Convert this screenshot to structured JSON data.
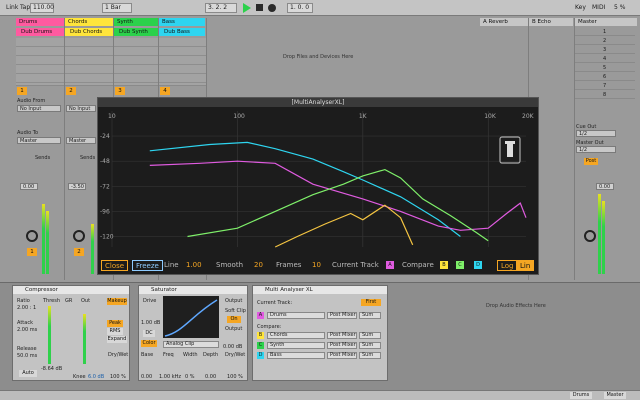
{
  "transport": {
    "link": "Link",
    "tap": "Tap",
    "tempo": "110.00",
    "bar_mode": "1 Bar",
    "position": "3. 2. 2",
    "position2": "1. 0. 0",
    "key": "Key",
    "midi": "MIDI",
    "cpu": "5 %"
  },
  "tracks": [
    {
      "name": "Drums",
      "color": "#ff5aa0",
      "clip": "Dub Drums",
      "clip_color": "#ff5aa0",
      "num": "1"
    },
    {
      "name": "Chords",
      "color": "#ffe53b",
      "clip": "Dub Chords",
      "clip_color": "#ffe53b",
      "num": "2"
    },
    {
      "name": "Synth",
      "color": "#2bd14b",
      "clip": "Dub Synth",
      "clip_color": "#2bd14b",
      "num": "3"
    },
    {
      "name": "Bass",
      "color": "#2ed5f0",
      "clip": "Dub Bass",
      "clip_color": "#2ed5f0",
      "num": "4"
    }
  ],
  "returns": {
    "a": "A Reverb",
    "b": "B Echo",
    "master": "Master"
  },
  "master_scenes": [
    "1",
    "2",
    "3",
    "4",
    "5",
    "6",
    "7",
    "8"
  ],
  "mixer": {
    "audio_from": "Audio From",
    "no_input": "No Input",
    "audio_to": "Audio To",
    "master": "Master",
    "sends": "Sends",
    "cue_out": "Cue Out",
    "cue_val": "1/2",
    "master_out": "Master Out",
    "master_out_val": "1/2",
    "post": "Post",
    "volume_vals": [
      "0.00",
      "-3.50",
      "-3.00",
      "-1.00"
    ],
    "master_vol": "0.00"
  },
  "drop_files": "Drop Files and Devices Here",
  "drop_effects": "Drop Audio Effects Here",
  "analyser": {
    "title": "[MultiAnalyserXL]",
    "freq_labels": [
      "10",
      "100",
      "1K",
      "10K",
      "20K"
    ],
    "db_labels": [
      "-24",
      "-48",
      "-72",
      "-96",
      "-120"
    ],
    "close": "Close",
    "freeze": "Freeze",
    "line_label": "Line",
    "line_val": "1.00",
    "smooth_label": "Smooth",
    "smooth_val": "20",
    "frames_label": "Frames",
    "frames_val": "10",
    "current_track_label": "Current Track",
    "current_track_val": "A",
    "compare_label": "Compare",
    "compare_vals": [
      "B",
      "C",
      "D"
    ],
    "log": "Log",
    "lin": "Lin"
  },
  "compressor": {
    "title": "Compressor",
    "ratio": "Ratio",
    "ratio_val": "2.00 : 1",
    "attack": "Attack",
    "attack_val": "2.00 ms",
    "release": "Release",
    "release_val": "50.0 ms",
    "auto": "Auto",
    "thresh": "Thresh",
    "gr": "GR",
    "out": "Out",
    "thresh_val": "-8.64 dB",
    "knee": "Knee",
    "knee_val": "6.0 dB",
    "makeup": "Makeup",
    "peak": "Peak",
    "rms": "RMS",
    "expand": "Expand",
    "drywet": "Dry/Wet",
    "drywet_val": "100 %"
  },
  "saturator": {
    "title": "Saturator",
    "drive": "Drive",
    "drive_val": "1.00 dB",
    "dc": "DC",
    "color": "Color",
    "analog_clip": "Analog Clip",
    "base": "Base",
    "freq": "Freq",
    "width": "Width",
    "depth": "Depth",
    "base_val": "0.00",
    "freq_val": "1.00 kHz",
    "width_val": "0 %",
    "depth_val": "0.00",
    "output": "Output",
    "soft_clip": "Soft Clip",
    "on": "On",
    "output_val": "0.00 dB",
    "drywet": "Dry/Wet",
    "drywet_val": "100 %"
  },
  "mxl": {
    "title": "Multi Analyser XL",
    "current_track": "Current Track:",
    "first": "First",
    "row_a": {
      "letter": "A",
      "track": "Drums",
      "mode": "Post Mixer",
      "func": "Sum"
    },
    "compare": "Compare:",
    "rows": [
      {
        "letter": "B",
        "color": "#ffe53b",
        "track": "Chords",
        "mode": "Post Mixer",
        "func": "Sum"
      },
      {
        "letter": "C",
        "color": "#2bd14b",
        "track": "Synth",
        "mode": "Post Mixer",
        "func": "Sum"
      },
      {
        "letter": "D",
        "color": "#2ed5f0",
        "track": "Bass",
        "mode": "Post Mixer",
        "func": "Sum"
      }
    ]
  },
  "status": {
    "left": "Drums",
    "right": "Master"
  },
  "chart_data": {
    "type": "line",
    "xlabel": "",
    "ylabel": "",
    "x_scale": "log",
    "xlim": [
      10,
      20000
    ],
    "ylim": [
      -130,
      0
    ],
    "series": [
      {
        "color": "#2ed5f0",
        "points": [
          [
            20,
            -38
          ],
          [
            60,
            -32
          ],
          [
            120,
            -30
          ],
          [
            200,
            -36
          ],
          [
            400,
            -46
          ],
          [
            700,
            -58
          ],
          [
            1000,
            -66
          ],
          [
            2000,
            -82
          ],
          [
            4000,
            -104
          ],
          [
            6000,
            -120
          ]
        ]
      },
      {
        "color": "#e05be0",
        "points": [
          [
            20,
            -52
          ],
          [
            50,
            -50
          ],
          [
            100,
            -48
          ],
          [
            200,
            -50
          ],
          [
            400,
            -70
          ],
          [
            1000,
            -84
          ],
          [
            2000,
            -96
          ],
          [
            4000,
            -110
          ],
          [
            6000,
            -114
          ],
          [
            10000,
            -112
          ],
          [
            14000,
            -98
          ],
          [
            18000,
            -88
          ],
          [
            20000,
            -102
          ]
        ]
      },
      {
        "color": "#7ff06a",
        "points": [
          [
            40,
            -120
          ],
          [
            100,
            -112
          ],
          [
            200,
            -96
          ],
          [
            400,
            -80
          ],
          [
            700,
            -70
          ],
          [
            1000,
            -62
          ],
          [
            1500,
            -56
          ],
          [
            2000,
            -64
          ],
          [
            3000,
            -84
          ],
          [
            5000,
            -100
          ],
          [
            8000,
            -116
          ],
          [
            10000,
            -124
          ]
        ]
      },
      {
        "color": "#f5c542",
        "points": [
          [
            200,
            -145
          ],
          [
            300,
            -120
          ],
          [
            500,
            -108
          ],
          [
            800,
            -98
          ],
          [
            1000,
            -104
          ],
          [
            1500,
            -90
          ],
          [
            2000,
            -102
          ],
          [
            2500,
            -128
          ]
        ]
      }
    ]
  }
}
